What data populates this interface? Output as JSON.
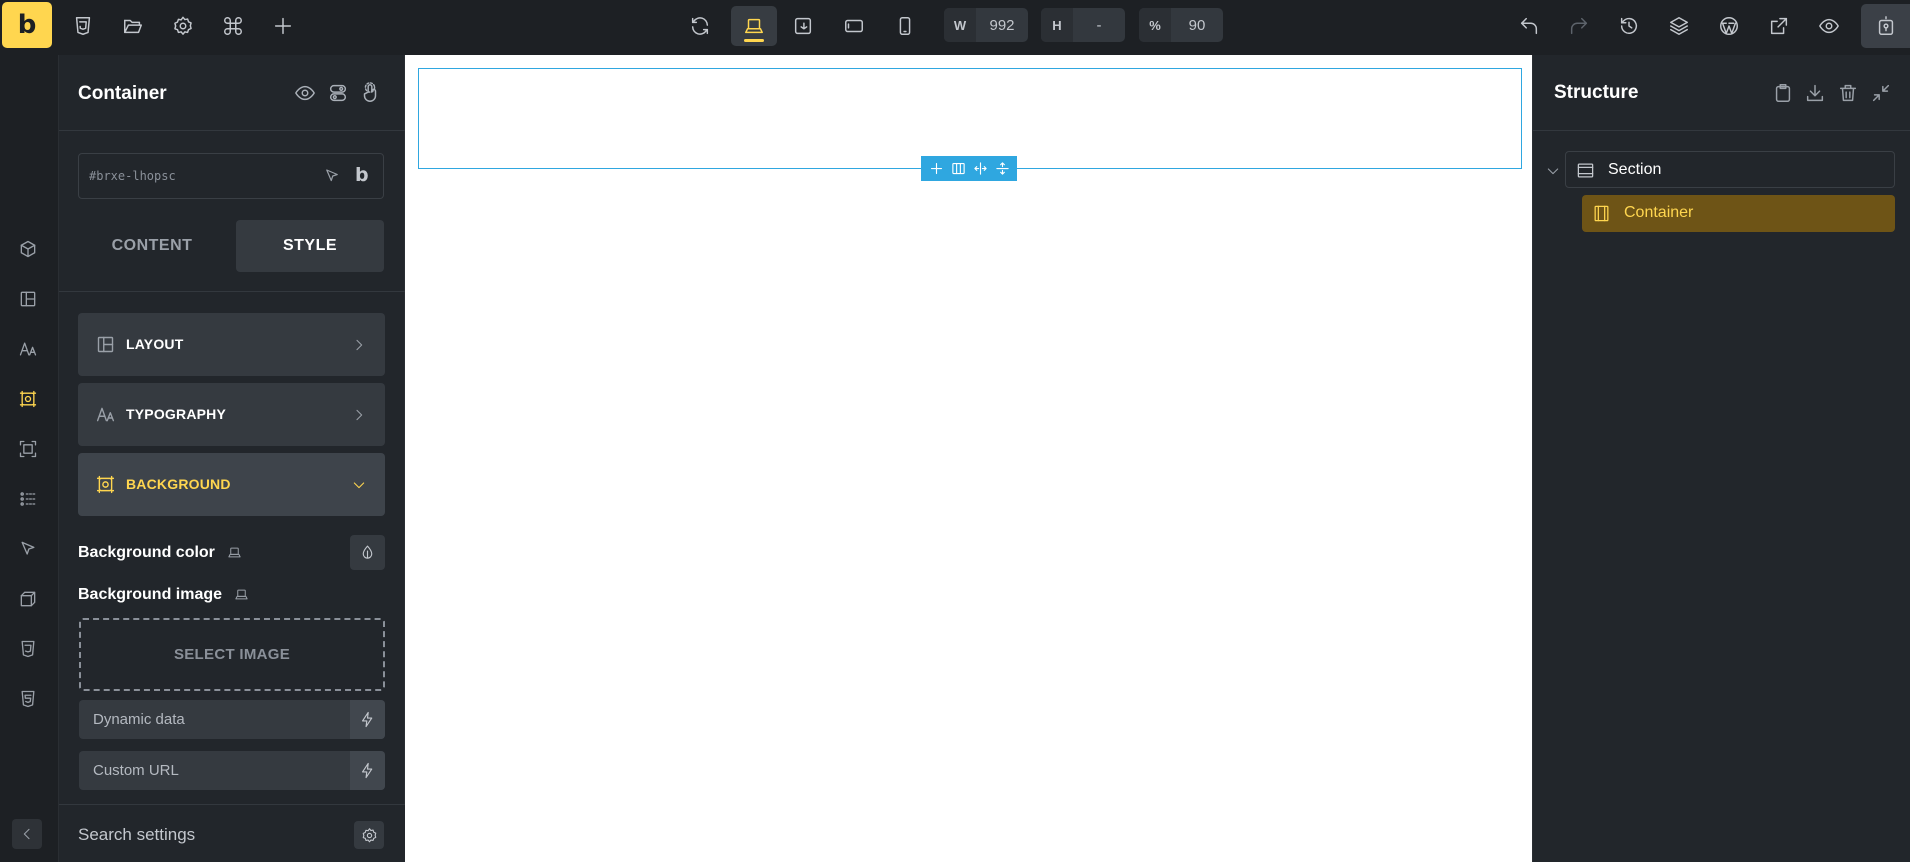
{
  "topbar": {
    "logo_letter": "b",
    "width_label": "W",
    "width_value": "992",
    "height_label": "H",
    "height_value": "-",
    "zoom_label": "%",
    "zoom_value": "90"
  },
  "panel": {
    "title": "Container",
    "element_id": "#brxe-lhopsc",
    "id_badge": "b",
    "tabs": {
      "content": "CONTENT",
      "style": "STYLE"
    },
    "sections": {
      "layout": "LAYOUT",
      "typography": "TYPOGRAPHY",
      "background": "BACKGROUND"
    },
    "controls": {
      "bg_color_label": "Background color",
      "bg_image_label": "Background image",
      "select_image": "SELECT IMAGE",
      "dynamic_data": "Dynamic data",
      "custom_url": "Custom URL"
    },
    "search_settings": "Search settings"
  },
  "structure": {
    "title": "Structure",
    "items": [
      {
        "label": "Section"
      },
      {
        "label": "Container"
      }
    ]
  },
  "colors": {
    "accent": "#ffd64f",
    "selection": "#2fa7e0",
    "panel_bg": "#22262b"
  }
}
